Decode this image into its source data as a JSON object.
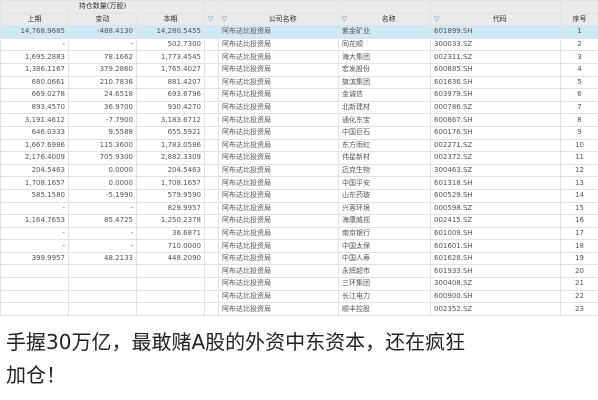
{
  "table": {
    "group_header": "持仓数量(万股)",
    "headers": [
      "上期",
      "变动",
      "本期",
      "公司名称",
      "名称",
      "代码",
      "序号"
    ],
    "rows": [
      [
        "14,768.9685",
        "-488.4130",
        "14,280.5455",
        "阿布达比投资局",
        "紫金矿业",
        "601899.SH",
        "1"
      ],
      [
        "-",
        "-",
        "502.7300",
        "阿布达比投资局",
        "同花顺",
        "300033.SZ",
        "2"
      ],
      [
        "1,695.2883",
        "78.1662",
        "1,773.4545",
        "阿布达比投资局",
        "海大集团",
        "002311.SZ",
        "3"
      ],
      [
        "1,386.1167",
        "379.2860",
        "1,765.4027",
        "阿布达比投资局",
        "宏发股份",
        "600885.SH",
        "4"
      ],
      [
        "680.0661",
        "210.7836",
        "881.4207",
        "阿布达比投资局",
        "旗滨集团",
        "601636.SH",
        "5"
      ],
      [
        "669.0278",
        "24.6518",
        "693.6796",
        "阿布达比投资局",
        "金诚信",
        "603979.SH",
        "6"
      ],
      [
        "893.4570",
        "36.9700",
        "930.4270",
        "阿布达比投资局",
        "北新建材",
        "000786.SZ",
        "7"
      ],
      [
        "3,191.4612",
        "-7.7900",
        "3,183.6712",
        "阿布达比投资局",
        "通化东宝",
        "600867.SH",
        "8"
      ],
      [
        "646.0333",
        "9.5588",
        "655.5921",
        "阿布达比投资局",
        "中国巨石",
        "600176.SH",
        "9"
      ],
      [
        "1,667.6986",
        "115.3600",
        "1,783.0586",
        "阿布达比投资局",
        "东方雨虹",
        "002271.SZ",
        "10"
      ],
      [
        "2,176.4009",
        "705.9300",
        "2,882.3309",
        "阿布达比投资局",
        "伟星新材",
        "002372.SZ",
        "11"
      ],
      [
        "204.5463",
        "0.0000",
        "204.5463",
        "阿布达比投资局",
        "迈克生物",
        "300463.SZ",
        "12"
      ],
      [
        "1,708.1657",
        "0.0000",
        "1,708.1657",
        "阿布达比投资局",
        "中国平安",
        "601318.SH",
        "13"
      ],
      [
        "585.1580",
        "-5.1990",
        "579.9590",
        "阿布达比投资局",
        "山东药玻",
        "600529.SH",
        "14"
      ],
      [
        "-",
        "-",
        "829.9957",
        "阿布达比投资局",
        "兴蓉环境",
        "000598.SZ",
        "15"
      ],
      [
        "1,164.7653",
        "85.4725",
        "1,250.2378",
        "阿布达比投资局",
        "海康威视",
        "002415.SZ",
        "16"
      ],
      [
        "-",
        "-",
        "36.6871",
        "阿布达比投资局",
        "南京银行",
        "601009.SH",
        "17"
      ],
      [
        "-",
        "-",
        "710.0000",
        "阿布达比投资局",
        "中国太保",
        "601601.SH",
        "18"
      ],
      [
        "399.9957",
        "48.2133",
        "448.2090",
        "阿布达比投资局",
        "中国人寿",
        "601628.SH",
        "19"
      ],
      [
        "",
        "",
        "",
        "阿布达比投资局",
        "永辉超市",
        "601933.SH",
        "20"
      ],
      [
        "",
        "",
        "",
        "阿布达比投资局",
        "三环集团",
        "300408.SZ",
        "21"
      ],
      [
        "",
        "",
        "",
        "阿布达比投资局",
        "长江电力",
        "600900.SH",
        "22"
      ],
      [
        "",
        "",
        "",
        "阿布达比投资局",
        "顺丰控股",
        "002352.SZ",
        "23"
      ]
    ]
  },
  "caption": {
    "line1": "手握30万亿，最敢赌A股的外资中东资本，还在疯狂",
    "line2": "加仓！"
  },
  "colors": {
    "selected_row": "#cfe8f7",
    "header_bg": "#eaeaea",
    "filter_icon": "#4a90c8"
  }
}
